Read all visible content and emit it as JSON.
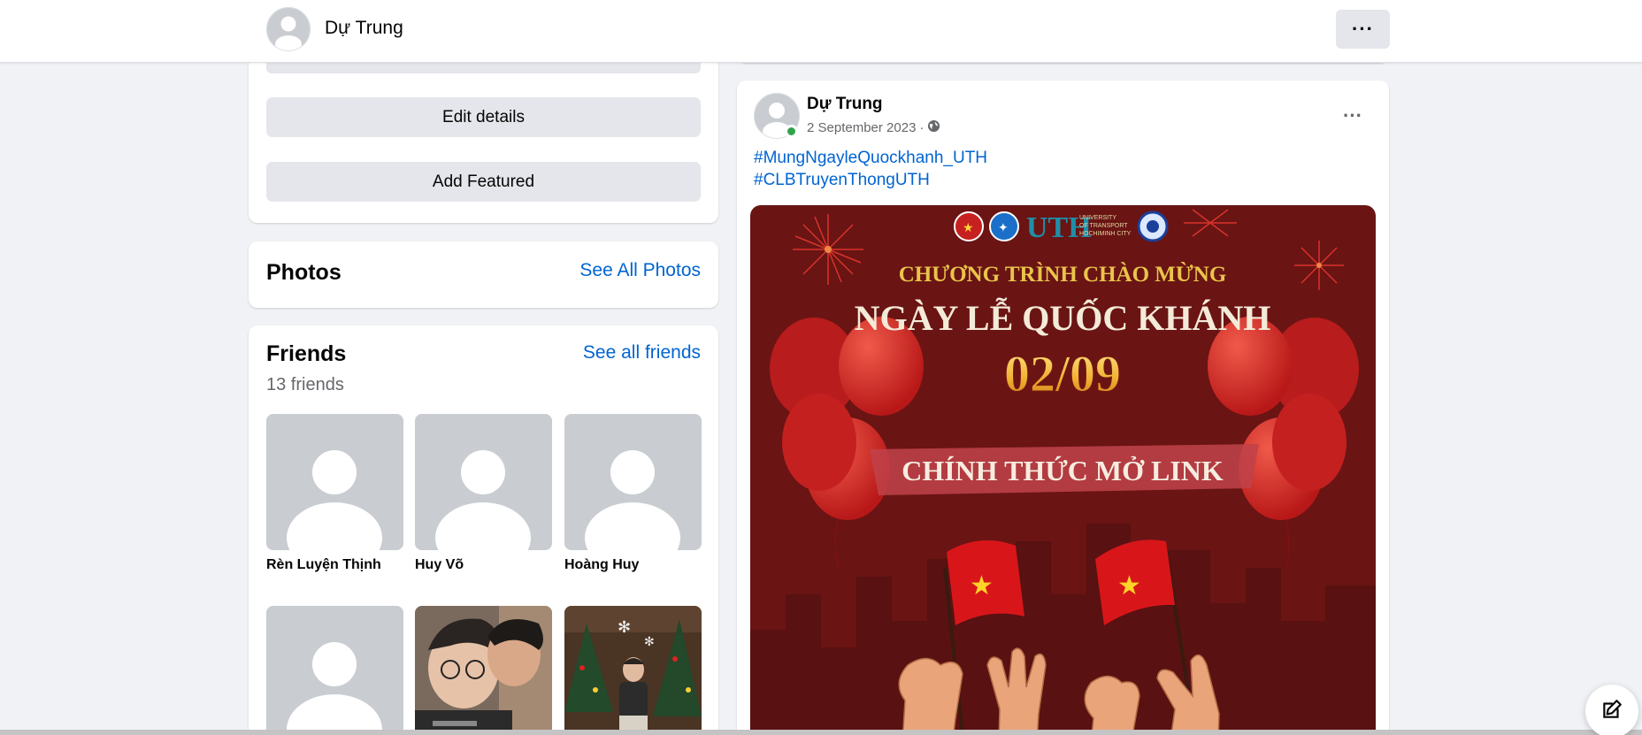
{
  "header": {
    "profile_name": "Dự Trung",
    "more_label": "···"
  },
  "intro": {
    "edit_details_label": "Edit details",
    "add_featured_label": "Add Featured"
  },
  "photos": {
    "title": "Photos",
    "see_all_label": "See All Photos"
  },
  "friends": {
    "title": "Friends",
    "see_all_label": "See all friends",
    "count_text": "13 friends",
    "items": [
      {
        "name": "Rèn Luyện Thịnh",
        "avatar": "default-avatar"
      },
      {
        "name": "Huy Võ",
        "avatar": "default-avatar"
      },
      {
        "name": "Hoàng Huy",
        "avatar": "default-avatar"
      },
      {
        "name": "",
        "avatar": "default-avatar"
      },
      {
        "name": "",
        "avatar": "photo-two-people-selfie"
      },
      {
        "name": "",
        "avatar": "photo-person-christmas-trees"
      }
    ]
  },
  "post": {
    "author": "Dự Trung",
    "date": "2 September 2023",
    "separator": "·",
    "audience_icon": "globe-icon",
    "menu_label": "···",
    "hashtags": [
      "#MungNgayleQuockhanh_UTH",
      "#CLBTruyenThongUTH"
    ],
    "image": {
      "logo_text": "UTH",
      "logo_subtext_1": "UNIVERSITY",
      "logo_subtext_2": "OF TRANSPORT",
      "logo_subtext_3": "HOCHIMINH CITY",
      "line1": "CHƯƠNG TRÌNH CHÀO MỪNG",
      "line2": "NGÀY LỄ QUỐC KHÁNH",
      "line3": "02/09",
      "banner": "CHÍNH THỨC MỞ LINK"
    }
  },
  "colors": {
    "link_blue": "#0064d1",
    "button_gray": "#e4e6eb",
    "online_green": "#31a24c",
    "poster_red": "#6a1414"
  }
}
